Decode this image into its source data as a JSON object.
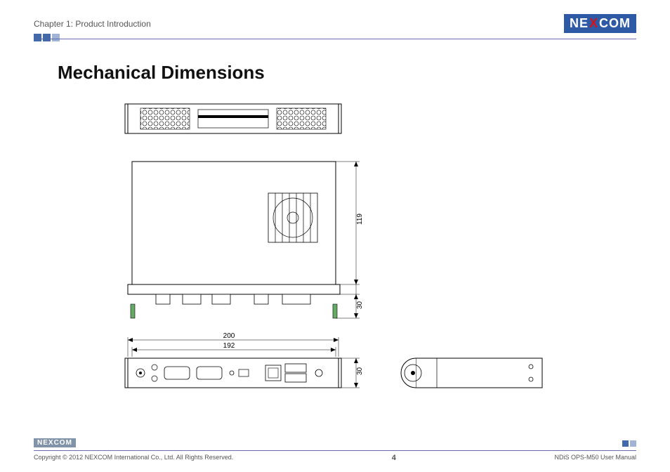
{
  "header": {
    "chapter": "Chapter 1: Product Introduction",
    "brand": "NEXCOM"
  },
  "title": "Mechanical Dimensions",
  "dimensions": {
    "width_outer": "200",
    "width_inner": "192",
    "height_body": "119",
    "height_port": "30",
    "height_front": "30"
  },
  "footer": {
    "copyright": "Copyright © 2012 NEXCOM International Co., Ltd. All Rights Reserved.",
    "page": "4",
    "manual": "NDiS OPS-M50 User Manual"
  }
}
